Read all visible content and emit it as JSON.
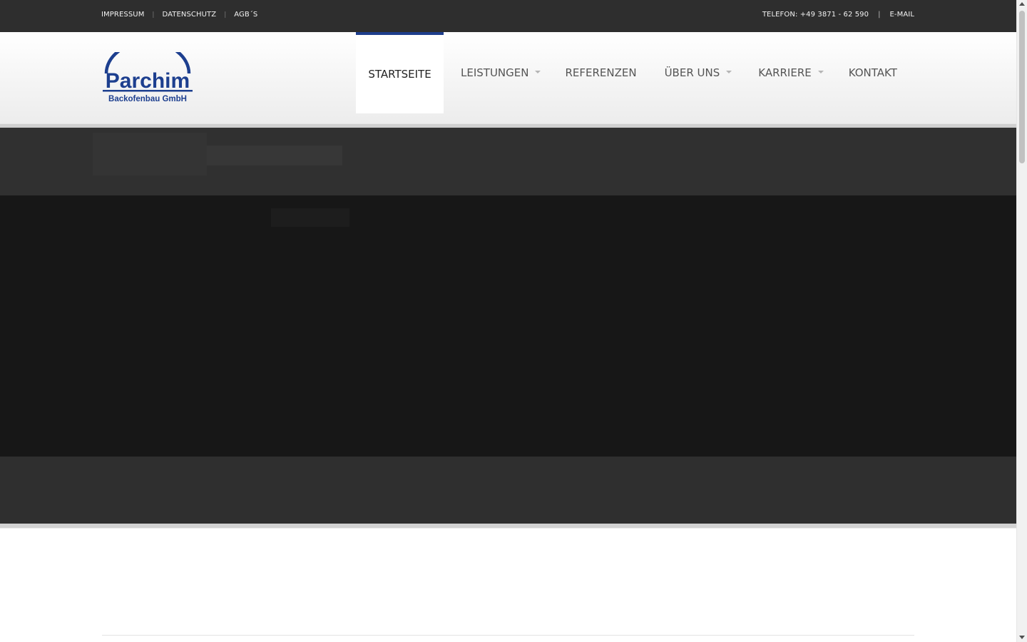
{
  "topbar": {
    "left_links": [
      "IMPRESSUM",
      "DATENSCHUTZ",
      "AGB´S"
    ],
    "separator": "|",
    "phone": "TELEFON: +49 3871 - 62 590",
    "email": "E-MAIL"
  },
  "logo": {
    "brand": "Parchim",
    "subtitle": "Backofenbau GmbH",
    "color": "#1d3f8f"
  },
  "nav": {
    "items": [
      {
        "label": "STARTSEITE",
        "has_dropdown": false,
        "active": true
      },
      {
        "label": "LEISTUNGEN",
        "has_dropdown": true,
        "active": false
      },
      {
        "label": "REFERENZEN",
        "has_dropdown": false,
        "active": false
      },
      {
        "label": "ÜBER UNS",
        "has_dropdown": true,
        "active": false
      },
      {
        "label": "KARRIERE",
        "has_dropdown": true,
        "active": false
      },
      {
        "label": "KONTAKT",
        "has_dropdown": false,
        "active": false
      }
    ],
    "active_accent": "#1e3e8c"
  },
  "colors": {
    "topbar_bg": "#2e2e2e",
    "hero_dark": "#171717",
    "hero_band": "#303030"
  }
}
